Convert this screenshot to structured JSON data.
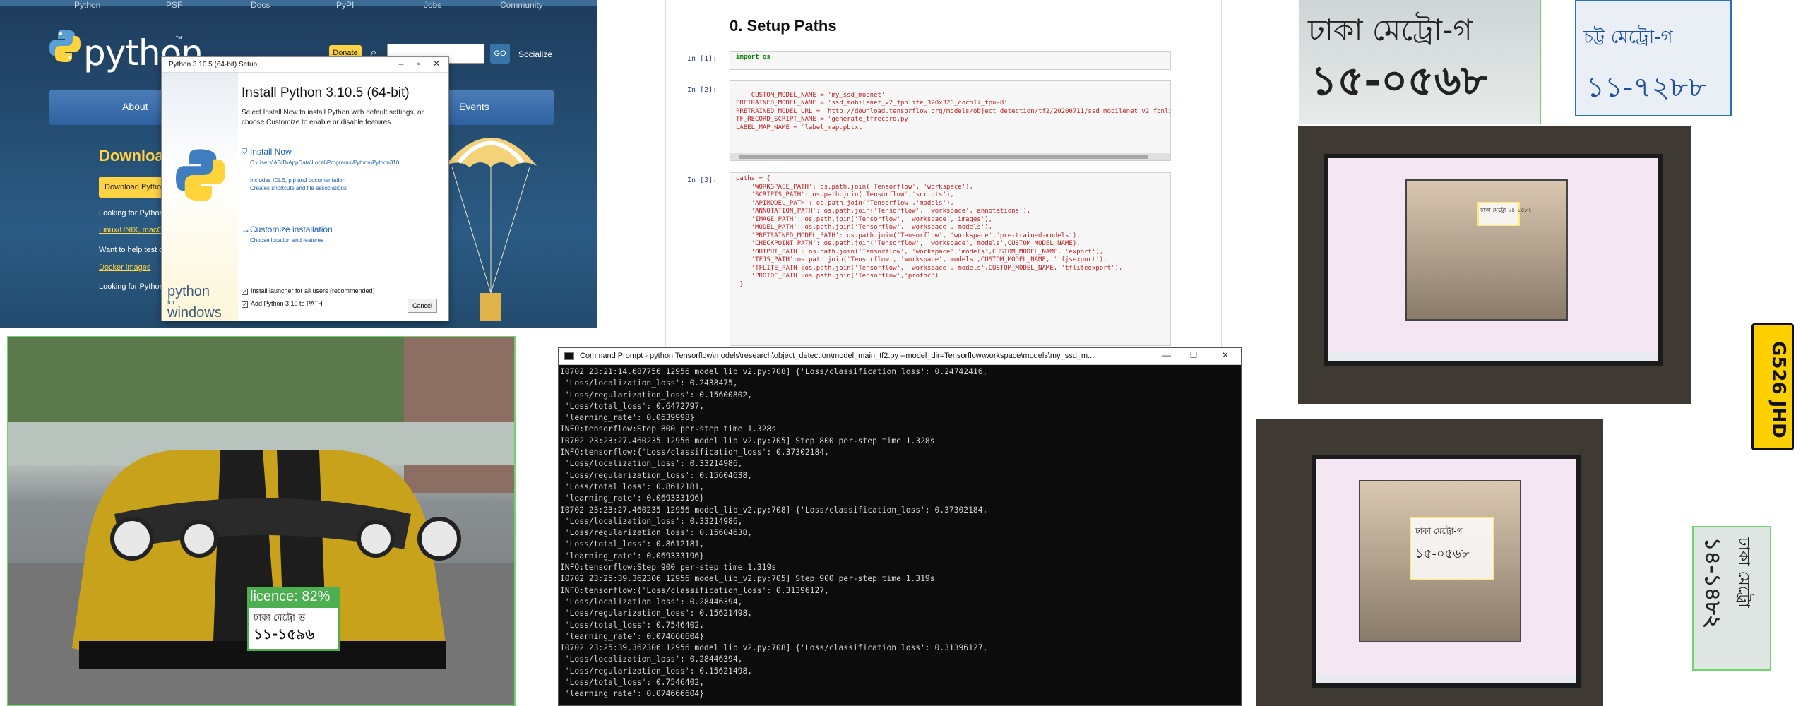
{
  "python_site": {
    "top_nav": [
      "Python",
      "PSF",
      "Docs",
      "PyPI",
      "Jobs",
      "Community"
    ],
    "logo_text": "python",
    "logo_tm": "™",
    "donate": "Donate",
    "search_placeholder": "",
    "go": "GO",
    "socialize": "Socialize",
    "nav": [
      "About",
      "Events"
    ],
    "download_heading": "Download th",
    "download_button": "Download Python 3",
    "lines": [
      "Looking for Python wi",
      "Want to help test dev",
      "Looking for Python 2."
    ],
    "links": [
      "Linux/UNIX, macOS, C",
      "Docker images"
    ],
    "installer": {
      "title": "Python 3.10.5 (64-bit) Setup",
      "heading": "Install Python 3.10.5 (64-bit)",
      "description": "Select Install Now to install Python with default settings, or choose Customize to enable or disable features.",
      "install_now": "Install Now",
      "install_path": "C:\\Users\\ABID\\AppData\\Local\\Programs\\Python\\Python310",
      "install_sub1": "Includes IDLE, pip and documentation",
      "install_sub2": "Creates shortcuts and file associations",
      "customize": "Customize installation",
      "customize_sub": "Choose location and features",
      "chk_launcher": "Install launcher for all users (recommended)",
      "chk_path": "Add Python 3.10 to PATH",
      "cancel": "Cancel",
      "side_text_1": "python",
      "side_text_2": "for",
      "side_text_3": "windows"
    }
  },
  "notebook": {
    "heading": "0. Setup Paths",
    "cells": [
      {
        "prompt": "In [1]:",
        "code": "import os"
      },
      {
        "prompt": "In [2]:",
        "code": "CUSTOM_MODEL_NAME = 'my_ssd_mobnet'\nPRETRAINED_MODEL_NAME = 'ssd_mobilenet_v2_fpnlite_320x320_coco17_tpu-8'\nPRETRAINED_MODEL_URL = 'http://download.tensorflow.org/models/object_detection/tf2/20200711/ssd_mobilenet_v2_fpnlite_320x320_coco\nTF_RECORD_SCRIPT_NAME = 'generate_tfrecord.py'\nLABEL_MAP_NAME = 'label_map.pbtxt'"
      },
      {
        "prompt": "In [3]:",
        "code": "paths = {\n    'WORKSPACE_PATH': os.path.join('Tensorflow', 'workspace'),\n    'SCRIPTS_PATH': os.path.join('Tensorflow','scripts'),\n    'APIMODEL_PATH': os.path.join('Tensorflow','models'),\n    'ANNOTATION_PATH': os.path.join('Tensorflow', 'workspace','annotations'),\n    'IMAGE_PATH': os.path.join('Tensorflow', 'workspace','images'),\n    'MODEL_PATH': os.path.join('Tensorflow', 'workspace','models'),\n    'PRETRAINED_MODEL_PATH': os.path.join('Tensorflow', 'workspace','pre-trained-models'),\n    'CHECKPOINT_PATH': os.path.join('Tensorflow', 'workspace','models',CUSTOM_MODEL_NAME),\n    'OUTPUT_PATH': os.path.join('Tensorflow', 'workspace','models',CUSTOM_MODEL_NAME, 'export'),\n    'TFJS_PATH':os.path.join('Tensorflow', 'workspace','models',CUSTOM_MODEL_NAME, 'tfjsexport'),\n    'TFLITE_PATH':os.path.join('Tensorflow', 'workspace','models',CUSTOM_MODEL_NAME, 'tfliteexport'),\n    'PROTOC_PATH':os.path.join('Tensorflow','protoc')\n }"
      }
    ]
  },
  "cmd": {
    "title": "Command Prompt - python  Tensorflow\\models\\research\\object_detection\\model_main_tf2.py --model_dir=Tensorflow\\workspace\\models\\my_ssd_m...",
    "minimize": "—",
    "maximize": "☐",
    "close": "✕",
    "output": "I0702 23:21:14.687756 12956 model_lib_v2.py:708] {'Loss/classification_loss': 0.24742416,\n 'Loss/localization_loss': 0.2438475,\n 'Loss/regularization_loss': 0.15600802,\n 'Loss/total_loss': 0.6472797,\n 'learning_rate': 0.0639998}\nINFO:tensorflow:Step 800 per-step time 1.328s\nI0702 23:23:27.460235 12956 model_lib_v2.py:705] Step 800 per-step time 1.328s\nINFO:tensorflow:{'Loss/classification_loss': 0.37302184,\n 'Loss/localization_loss': 0.33214986,\n 'Loss/regularization_loss': 0.15604638,\n 'Loss/total_loss': 0.8612181,\n 'learning_rate': 0.069333196}\nI0702 23:23:27.460235 12956 model_lib_v2.py:708] {'Loss/classification_loss': 0.37302184,\n 'Loss/localization_loss': 0.33214986,\n 'Loss/regularization_loss': 0.15604638,\n 'Loss/total_loss': 0.8612181,\n 'learning_rate': 0.069333196}\nINFO:tensorflow:Step 900 per-step time 1.319s\nI0702 23:25:39.362306 12956 model_lib_v2.py:705] Step 900 per-step time 1.319s\nINFO:tensorflow:{'Loss/classification_loss': 0.31396127,\n 'Loss/localization_loss': 0.28446394,\n 'Loss/regularization_loss': 0.15621498,\n 'Loss/total_loss': 0.7546402,\n 'learning_rate': 0.074666604}\nI0702 23:25:39.362306 12956 model_lib_v2.py:708] {'Loss/classification_loss': 0.31396127,\n 'Loss/localization_loss': 0.28446394,\n 'Loss/regularization_loss': 0.15621498,\n 'Loss/total_loss': 0.7546402,\n 'learning_rate': 0.074666604}"
  },
  "car_photo": {
    "detection_label": "licence: 82%",
    "plate_line1": "ঢাকা মেট্রো-ভ",
    "plate_line2": "১১-১৫৯৬",
    "accent": "#4caf50"
  },
  "plates": {
    "plate1_line1": "ঢাকা মেট্রো-গ",
    "plate1_line2": "১৫-০৫৬৮",
    "plate2_line1": "চট্ট মেট্রো-গ",
    "plate2_line2": "১১-৭২৮৮",
    "plate3": "G526 JHD",
    "plate4_line1": "ঢাকা মেট্রো",
    "plate4_line2": "১৪-১৪৮২",
    "monitor1_plate": "ঢাকা মেট্রো ১৪-১৪৮২",
    "monitor2_plate_line1": "ঢাকা মেট্রো-গ",
    "monitor2_plate_line2": "১৫-০৫৬৮"
  }
}
